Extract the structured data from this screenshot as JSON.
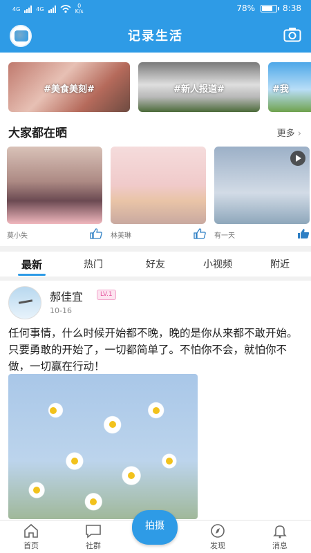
{
  "status": {
    "net1": "4G",
    "net2": "4G",
    "speed_value": "0",
    "speed_unit": "K/s",
    "battery": "78%",
    "battery_level": 78,
    "time": "8:38"
  },
  "topbar": {
    "title": "记录生活"
  },
  "topics": [
    {
      "label": "#美食美刻#"
    },
    {
      "label": "#新人报道#"
    },
    {
      "label": "#我"
    }
  ],
  "section": {
    "title": "大家都在晒",
    "more": "更多"
  },
  "cards": [
    {
      "user": "莫小失"
    },
    {
      "user": "林美琳"
    },
    {
      "user": "有一天"
    }
  ],
  "tabs": [
    {
      "label": "最新"
    },
    {
      "label": "热门"
    },
    {
      "label": "好友"
    },
    {
      "label": "小视频"
    },
    {
      "label": "附近"
    }
  ],
  "post": {
    "name": "郝佳宜",
    "level": "LV.1",
    "date": "10-16",
    "text": "任何事情，什么时候开始都不晚，晚的是你从来都不敢开始。只要勇敢的开始了，一切都简单了。不怕你不会，就怕你不做，一切赢在行动！"
  },
  "bottomnav": {
    "home": "首页",
    "community": "社群",
    "shoot": "拍摄",
    "discover": "发现",
    "messages": "消息"
  },
  "colors": {
    "primary": "#2e9be6",
    "level_badge": "#e4559e"
  }
}
